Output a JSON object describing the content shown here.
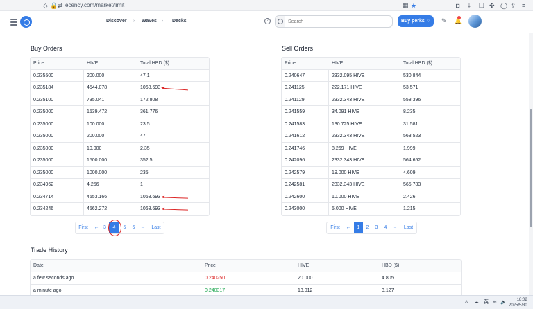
{
  "browser": {
    "url": "ecency.com/market/limit"
  },
  "header": {
    "nav": [
      "Discover",
      "Waves",
      "Decks"
    ],
    "search_placeholder": "Search",
    "buy_perks": "Buy perks"
  },
  "buy_orders": {
    "title": "Buy Orders",
    "columns": [
      "Price",
      "HIVE",
      "Total HBD ($)"
    ],
    "rows": [
      [
        "0.235500",
        "200.000",
        "47.1"
      ],
      [
        "0.235184",
        "4544.078",
        "1068.693"
      ],
      [
        "0.235100",
        "735.041",
        "172.808"
      ],
      [
        "0.235000",
        "1539.472",
        "361.776"
      ],
      [
        "0.235000",
        "100.000",
        "23.5"
      ],
      [
        "0.235000",
        "200.000",
        "47"
      ],
      [
        "0.235000",
        "10.000",
        "2.35"
      ],
      [
        "0.235000",
        "1500.000",
        "352.5"
      ],
      [
        "0.235000",
        "1000.000",
        "235"
      ],
      [
        "0.234962",
        "4.256",
        "1"
      ],
      [
        "0.234714",
        "4553.166",
        "1068.693"
      ],
      [
        "0.234246",
        "4562.272",
        "1068.693"
      ]
    ],
    "pager": [
      "First",
      "←",
      "3",
      "4",
      "5",
      "6",
      "→",
      "Last"
    ],
    "active_page": "4"
  },
  "sell_orders": {
    "title": "Sell Orders",
    "columns": [
      "Price",
      "HIVE",
      "Total HBD ($)"
    ],
    "rows": [
      [
        "0.240647",
        "2332.095 HIVE",
        "530.844"
      ],
      [
        "0.241125",
        "222.171 HIVE",
        "53.571"
      ],
      [
        "0.241129",
        "2332.343 HIVE",
        "558.396"
      ],
      [
        "0.241559",
        "34.091 HIVE",
        "8.235"
      ],
      [
        "0.241583",
        "130.725 HIVE",
        "31.581"
      ],
      [
        "0.241612",
        "2332.343 HIVE",
        "563.523"
      ],
      [
        "0.241746",
        "8.269 HIVE",
        "1.999"
      ],
      [
        "0.242096",
        "2332.343 HIVE",
        "564.652"
      ],
      [
        "0.242579",
        "19.000 HIVE",
        "4.609"
      ],
      [
        "0.242581",
        "2332.343 HIVE",
        "565.783"
      ],
      [
        "0.242600",
        "10.000 HIVE",
        "2.426"
      ],
      [
        "0.243000",
        "5.000 HIVE",
        "1.215"
      ]
    ],
    "pager": [
      "First",
      "←",
      "1",
      "2",
      "3",
      "4",
      "→",
      "Last"
    ],
    "active_page": "1"
  },
  "trade_history": {
    "title": "Trade History",
    "columns": [
      "Date",
      "Price",
      "HIVE",
      "HBD ($)"
    ],
    "rows": [
      {
        "date": "a few seconds ago",
        "price": "0.240250",
        "hive": "20.000",
        "hbd": "4.805",
        "side": "sell"
      },
      {
        "date": "a minute ago",
        "price": "0.240317",
        "hive": "13.012",
        "hbd": "3.127",
        "side": "buy"
      }
    ]
  },
  "taskbar": {
    "lang": "英",
    "time": "18:02",
    "date": "2025/5/30"
  },
  "colors": {
    "accent": "#357ce6",
    "sell": "#dc2626",
    "buy": "#16a34a",
    "annotation": "#dc2626"
  }
}
